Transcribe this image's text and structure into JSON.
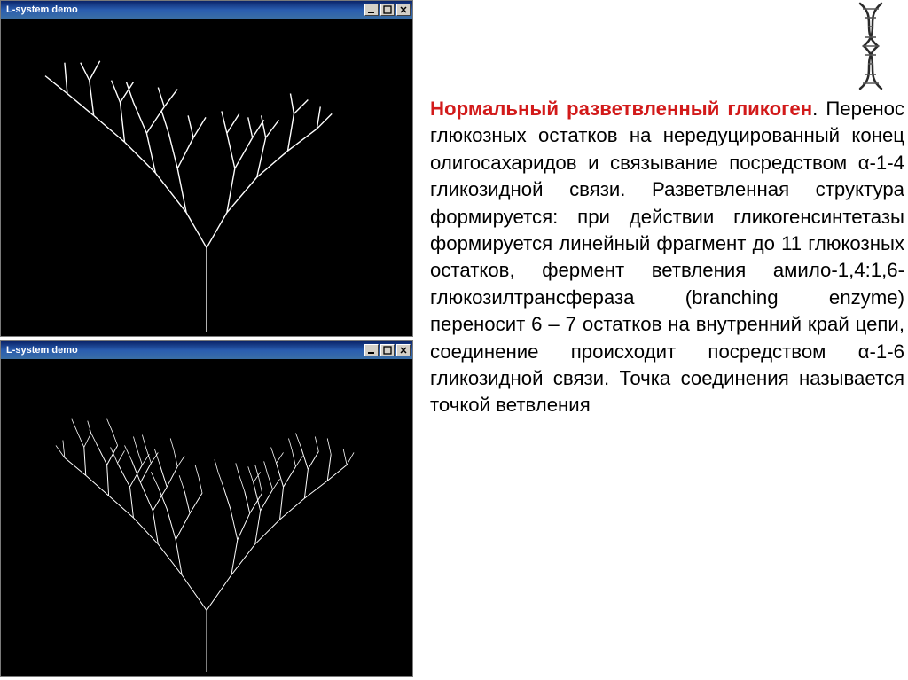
{
  "windows": {
    "top": {
      "title": "L-system demo"
    },
    "bottom": {
      "title": "L-system demo"
    }
  },
  "buttons": {
    "minimize": "–",
    "maximize": "□",
    "close": "×"
  },
  "text": {
    "heading": "Нормальный разветвленный гликоген",
    "body": ". Перенос глюкозных остатков на нередуцированный конец олигосахаридов и связывание посредством α-1-4 гликозидной связи. Разветвленная структура формируется: при действии гликогенсинтетазы формируется линейный фрагмент до 11 глюкозных остатков, фермент ветвления амило-1,4:1,6-глюкозилтрансфераза (branching enzyme) переносит 6 – 7 остатков на внутренний край цепи, соединение происходит посредством α-1-6 гликозидной связи. Точка соединения называется точкой ветвления"
  },
  "decor": {
    "dna": "dna-helix"
  }
}
